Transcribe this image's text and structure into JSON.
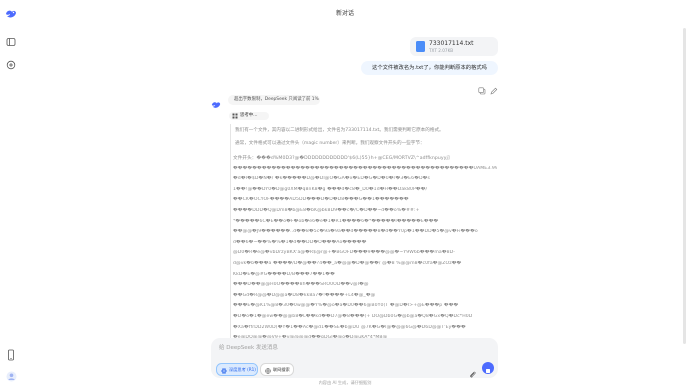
{
  "header": {
    "title": "新对话"
  },
  "sidebar": {
    "icons": [
      "deepseek-logo-icon",
      "sidebar-toggle-icon",
      "new-chat-icon",
      "mobile-icon",
      "avatar-icon"
    ]
  },
  "file": {
    "name": "733017114.txt",
    "size": "TXT 2.07KB"
  },
  "user_message": "这个文件被改名为.txt了，你能判断原本的格式吗",
  "assistant": {
    "search_notice": "超出字数限制，DeepSeek 只阅读了前 1%",
    "thinking_label": "思考中…",
    "thinking_paragraphs": [
      "我们有一个文件，其内容以二进制形式给出，文件名为733017114.txt。我们需要判断它原本的格式。",
      "通常，文件格式可以通过文件头（magic number）来判断。我们观察文件开头的一些字节："
    ],
    "garbled_lines": [
      "文件开头：���d%M0D3?@�DDDDDDDDDDDD'$6(L)55}h+@CEG/MORTVZ\\^adffknpuyyj]",
      "��������������������������������������������������UAME3.99r",
      "�d�I�$D�N�/ �k�����D@�DI@O�GA�x�ED�G�D�0�r�3�E6�D�s",
      "1��!@��DY0�D@g0XM�q8nK8�g ���d�c8�_D0�1d�H��Dak80P��/",
      "��CK�OCYOF����AD5DD���D�D�D8���G��1�������",
      "����DDD�Q@Dm8�b@E8�bK@bk8D9��c�/C�D��~d��o%�##:+",
      "*�����6C�E��o�F�ob�e6�e�1�R1����6�*�����I�����E���",
      "��@@�J9������..d��8�5c�9a�9a��d�����8�d��Y0p�1��DD�5�@v�Fi���o",
      "d��6�~��%�%�1�d��DD�O���Ao�����",
      "@D0�R�e@�vbDrzyBKX'a@�R$@r@+�BGOFD���9���@@�~Y9W6b���ma�8D-",
      "d@vk�b���a ����/D�@��?4��_a�@@�D�@��/ @�8 %@@m8�c0fa�@ZOz��",
      "KkD�E�@#G����D/B���7��1��",
      "���D��@@H0O����8h���SRO0OD��v@I�@",
      "��Gd�R@@�D@@a�D8�kk8a7�!����+L4�@_�@",
      "���E�@K1%@8�30�0w@@�Y%�@o�a�D0��6@B0Y0(T �@D�I>+@E���p ���",
      "�D�o�1�@ew��@@b8�L��kd��D7@�8���(+ DO@Db0G�@b@a�Q8�Gx�Q�Dc*H0D",
      "�Xa�ffrDD2W0D(�Y�1��Ac�@d1��SE�b@DU @7K�G�I@�@@6G@�D6D@@T'Ey���",
      "�e@DQ@@�@V9+�v@@@@d��gDGI�@o�D@uKA*4*M8@",
      "DkOC@DOO8@D@�@�@�P@@�eH�a@�@@�@@D@@d�@b�OOO��@D@@a�@",
      "�8�N��@@@q@���@�@D9 kf�cRB�*M�^7�@�����k ���@b�@@D@@r"
    ]
  },
  "input": {
    "placeholder": "给 DeepSeek 发送消息",
    "deep_think_label": "深度思考 (R1)",
    "web_search_label": "联网搜索"
  },
  "footer": "内容由 AI 生成，请仔细甄别",
  "colors": {
    "accent": "#4d6bfe",
    "bubble": "#eff6ff",
    "think_text": "#8b8b8b"
  }
}
